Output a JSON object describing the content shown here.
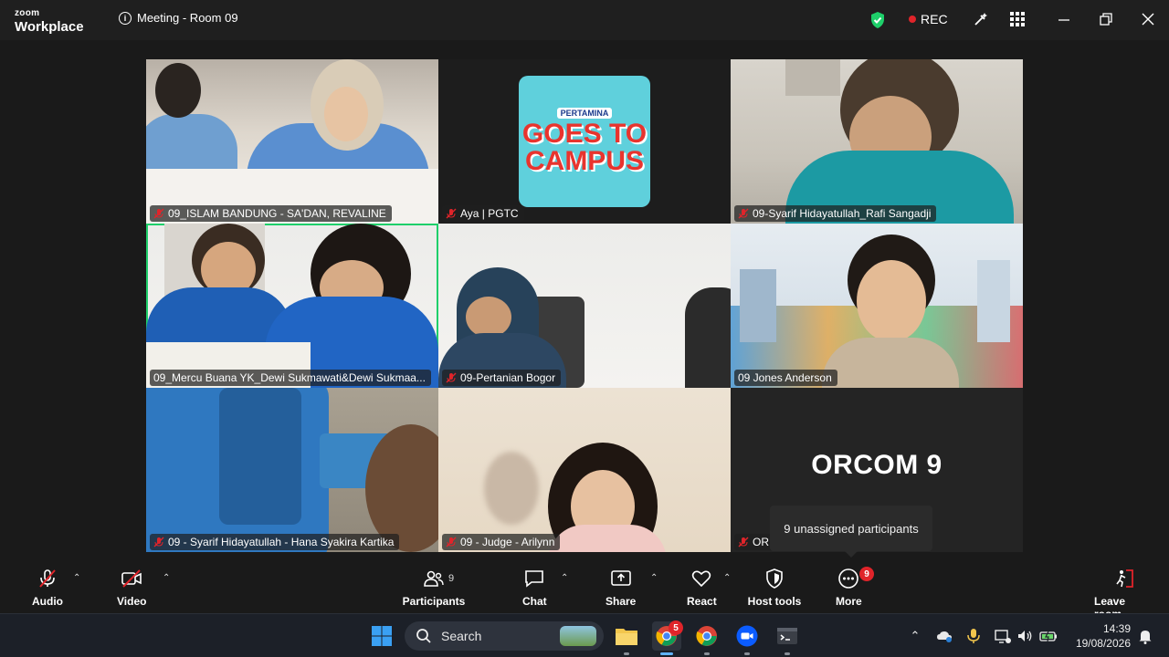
{
  "window": {
    "brand_small": "zoom",
    "brand_large": "Workplace",
    "meeting_title": "Meeting - Room 09",
    "rec_label": "REC"
  },
  "tiles": [
    {
      "name": "09_ISLAM BANDUNG - SA'DAN, REVALINE",
      "muted": true
    },
    {
      "name": "Aya | PGTC",
      "muted": true,
      "logo": {
        "line1": "PERTAMINA",
        "line2": "GOES TO",
        "line3": "CAMPUS"
      }
    },
    {
      "name": "09-Syarif Hidayatullah_Rafi Sangadji",
      "muted": true
    },
    {
      "name": "09_Mercu Buana YK_Dewi Sukmawati&Dewi Sukmaa...",
      "muted": false,
      "active": true
    },
    {
      "name": "09-Pertanian Bogor",
      "muted": true
    },
    {
      "name": "09 Jones Anderson",
      "muted": false
    },
    {
      "name": "09 - Syarif Hidayatullah - Hana Syakira Kartika",
      "muted": true
    },
    {
      "name": "09 - Judge - Arilynn",
      "muted": true
    },
    {
      "name": "ORCOM 9",
      "muted": true,
      "label_big": "ORCOM 9",
      "name_truncated": "OR"
    }
  ],
  "tooltip": "9 unassigned participants",
  "toolbar": {
    "audio": "Audio",
    "video": "Video",
    "participants": "Participants",
    "participants_count": "9",
    "chat": "Chat",
    "share": "Share",
    "react": "React",
    "host_tools": "Host tools",
    "more": "More",
    "more_badge": "9",
    "leave": "Leave room"
  },
  "taskbar": {
    "search_placeholder": "Search",
    "chrome_badge": "5",
    "time": "14:39",
    "date": "19/08/2026"
  },
  "colors": {
    "active_speaker": "#1ecf6a",
    "rec": "#e0242a",
    "shield": "#1ecf6a"
  }
}
